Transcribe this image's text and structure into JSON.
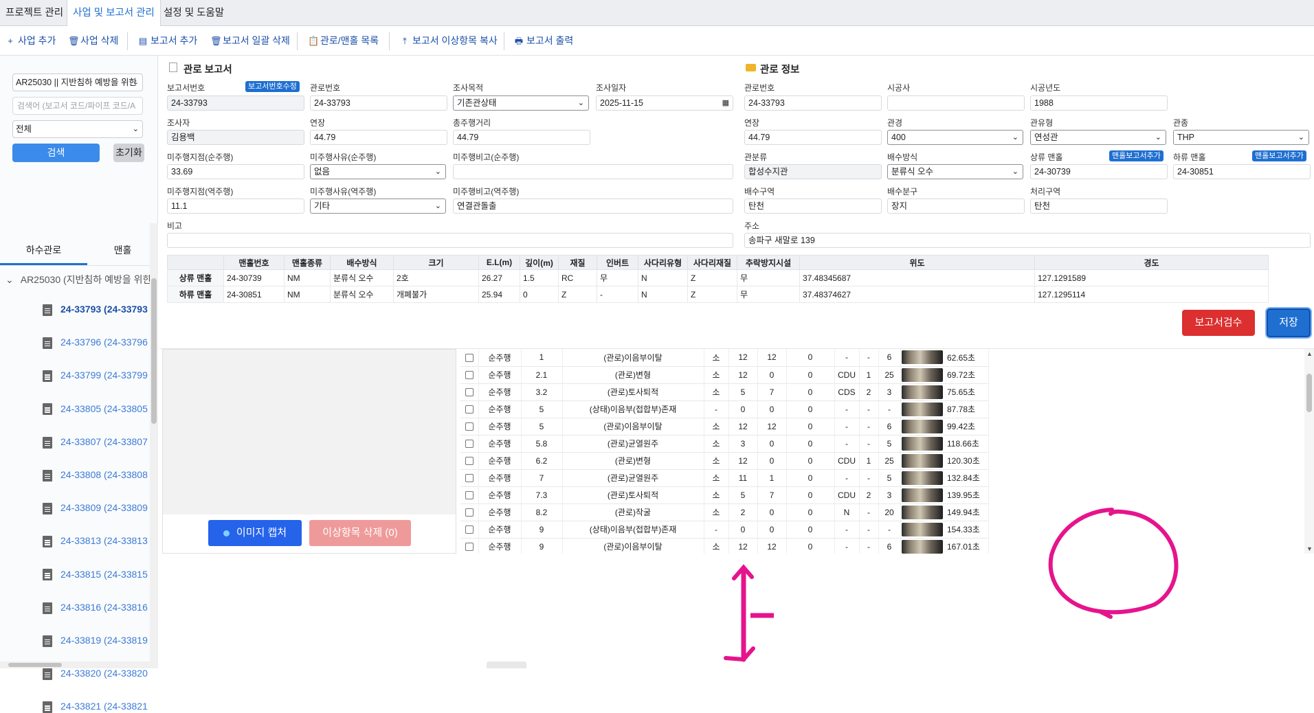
{
  "top_tabs": [
    "프로젝트 관리",
    "사업 및 보고서 관리",
    "설정 및 도움말"
  ],
  "toolbar": {
    "add_project": "사업 추가",
    "delete_project": "사업 삭제",
    "add_report": "보고서 추가",
    "bulk_delete_report": "보고서 일괄 삭제",
    "pipe_manhole_list": "관로/맨홀 목록",
    "copy_anomaly": "보고서 이상항목 복사",
    "print_report": "보고서 출력"
  },
  "sidebar": {
    "project_select": "AR25030 || 지반침하 예방을 위한",
    "search_placeholder": "검색어 (보고서 코드/파이프 코드/A",
    "filter_select": "전체",
    "search_button": "검색",
    "reset_button": "초기화",
    "tabs": [
      "하수관로",
      "맨홀"
    ],
    "tree_root": "AR25030 (지반침하 예방을 위한",
    "reports": [
      "24-33793 (24-33793",
      "24-33796 (24-33796",
      "24-33799 (24-33799",
      "24-33805 (24-33805",
      "24-33807 (24-33807",
      "24-33808 (24-33808",
      "24-33809 (24-33809",
      "24-33813 (24-33813",
      "24-33815 (24-33815",
      "24-33816 (24-33816",
      "24-33819 (24-33819",
      "24-33820 (24-33820",
      "24-33821 (24-33821"
    ]
  },
  "report": {
    "title": "관로 보고서",
    "fields": {
      "report_no_label": "보고서번호",
      "report_no": "24-33793",
      "report_no_edit": "보고서번호수정",
      "pipe_no_label": "관로번호",
      "pipe_no": "24-33793",
      "purpose_label": "조사목적",
      "purpose": "기존관상태",
      "date_label": "조사일자",
      "date": "2025-11-15",
      "surveyor_label": "조사자",
      "surveyor": "김용백",
      "length_label": "연장",
      "length": "44.79",
      "total_dist_label": "총주행거리",
      "total_dist": "44.79",
      "fwd_stop_label": "미주행지점(순주행)",
      "fwd_stop": "33.69",
      "fwd_reason_label": "미주행사유(순주행)",
      "fwd_reason": "없음",
      "fwd_note_label": "미주행비고(순주행)",
      "fwd_note": "",
      "rev_stop_label": "미주행지점(역주행)",
      "rev_stop": "11.1",
      "rev_reason_label": "미주행사유(역주행)",
      "rev_reason": "기타",
      "rev_note_label": "미주행비고(역주행)",
      "rev_note": "연결관돌출",
      "remark_label": "비고",
      "remark": ""
    }
  },
  "pipe": {
    "title": "관로 정보",
    "fields": {
      "pipe_no_label": "관로번호",
      "pipe_no": "24-33793",
      "builder_label": "시공사",
      "builder": "",
      "year_label": "시공년도",
      "year": "1988",
      "length_label": "연장",
      "length": "44.79",
      "diameter_label": "관경",
      "diameter": "400",
      "type_label": "관유형",
      "type": "연성관",
      "kind_label": "관종",
      "kind": "THP",
      "class_label": "관분류",
      "class": "합성수지관",
      "drain_label": "배수방식",
      "drain": "분류식 오수",
      "up_label": "상류 맨홀",
      "up": "24-30739",
      "up_add": "맨홀보고서추가",
      "down_label": "하류 맨홀",
      "down": "24-30851",
      "down_add": "맨홀보고서추가",
      "zone_label": "배수구역",
      "zone": "탄천",
      "subzone_label": "배수분구",
      "subzone": "장지",
      "treat_label": "처리구역",
      "treat": "탄천",
      "addr_label": "주소",
      "addr": "송파구 새말로 139"
    }
  },
  "manhole_table": {
    "headers": [
      "",
      "맨홀번호",
      "맨홀종류",
      "배수방식",
      "크기",
      "E.L(m)",
      "깊이(m)",
      "재질",
      "인버트",
      "사다리유형",
      "사다리재질",
      "추락방지시설",
      "위도",
      "경도"
    ],
    "rows": [
      [
        "상류 맨홀",
        "24-30739",
        "NM",
        "분류식 오수",
        "2호",
        "26.27",
        "1.5",
        "RC",
        "무",
        "N",
        "Z",
        "무",
        "37.48345687",
        "127.1291589"
      ],
      [
        "하류 맨홀",
        "24-30851",
        "NM",
        "분류식 오수",
        "개폐불가",
        "25.94",
        "0",
        "Z",
        "-",
        "N",
        "Z",
        "무",
        "37.48374627",
        "127.1295114"
      ]
    ]
  },
  "actions": {
    "review": "보고서검수",
    "save": "저장",
    "capture": "이미지 캡처",
    "delete_anomaly": "이상항목 삭제 (0)"
  },
  "defects": [
    [
      "순주행",
      "1",
      "(관로)이음부이탈",
      "소",
      "12",
      "12",
      "0",
      "-",
      "-",
      "6",
      "62.65초"
    ],
    [
      "순주행",
      "2.1",
      "(관로)변형",
      "소",
      "12",
      "0",
      "0",
      "CDU",
      "1",
      "25",
      "69.72초"
    ],
    [
      "순주행",
      "3.2",
      "(관로)토사퇴적",
      "소",
      "5",
      "7",
      "0",
      "CDS",
      "2",
      "3",
      "75.65초"
    ],
    [
      "순주행",
      "5",
      "(상태)이음부(접합부)존재",
      "-",
      "0",
      "0",
      "0",
      "-",
      "-",
      "-",
      "87.78초"
    ],
    [
      "순주행",
      "5",
      "(관로)이음부이탈",
      "소",
      "12",
      "12",
      "0",
      "-",
      "-",
      "6",
      "99.42초"
    ],
    [
      "순주행",
      "5.8",
      "(관로)균열원주",
      "소",
      "3",
      "0",
      "0",
      "-",
      "-",
      "5",
      "118.66초"
    ],
    [
      "순주행",
      "6.2",
      "(관로)변형",
      "소",
      "12",
      "0",
      "0",
      "CDU",
      "1",
      "25",
      "120.30초"
    ],
    [
      "순주행",
      "7",
      "(관로)균열원주",
      "소",
      "11",
      "1",
      "0",
      "-",
      "-",
      "5",
      "132.84초"
    ],
    [
      "순주행",
      "7.3",
      "(관로)토사퇴적",
      "소",
      "5",
      "7",
      "0",
      "CDU",
      "2",
      "3",
      "139.95초"
    ],
    [
      "순주행",
      "8.2",
      "(관로)작굴",
      "소",
      "2",
      "0",
      "0",
      "N",
      "-",
      "20",
      "149.94초"
    ],
    [
      "순주행",
      "9",
      "(상태)이음부(접합부)존재",
      "-",
      "0",
      "0",
      "0",
      "-",
      "-",
      "-",
      "154.33초"
    ],
    [
      "순주행",
      "9",
      "(관로)이음부이탈",
      "소",
      "12",
      "12",
      "0",
      "-",
      "-",
      "6",
      "167.01초"
    ]
  ],
  "annotation_color": "#e6148c"
}
